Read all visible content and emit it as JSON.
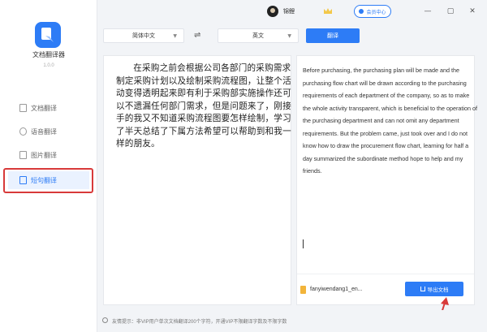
{
  "sidebar": {
    "app_name": "文档翻译器",
    "version": "1.0.0",
    "items": [
      {
        "label": "文档翻译"
      },
      {
        "label": "语音翻译"
      },
      {
        "label": "图片翻译"
      },
      {
        "label": "短句翻译"
      }
    ],
    "active_index": 3
  },
  "titlebar": {
    "username": "锦鲤",
    "vip_label": "会员中心",
    "minimize": "—",
    "maximize": "▢",
    "close": "✕"
  },
  "toolbar": {
    "source_lang": "简体中文",
    "swap_symbol": "⇌",
    "target_lang": "英文",
    "translate_label": "翻译"
  },
  "source_panel": {
    "text": "在采购之前会根据公司各部门的采购需求制定采购计划以及绘制采购流程图，让整个活动变得透明起来即有利于采购部实施操作还可以不遗漏任何部门需求，但是问题来了，刚接手的我又不知道采购流程图要怎样绘制，学习了半天总结了下属方法希望可以帮助到和我一样的朋友。"
  },
  "target_panel": {
    "text": "Before purchasing, the purchasing plan will be made and the purchasing flow chart will be drawn according to the purchasing requirements of each department of the company, so as to make the whole activity transparent, which is beneficial to the operation of the purchasing department and can not omit any department requirements. But the problem came, just took over and I do not know how to draw the procurement flow chart, learning for half a day summarized the subordinate method hope to help and my friends.",
    "file_name": "fanyiwendang1_en...",
    "export_label": "导出文档"
  },
  "footer": {
    "note": "友情提示：非VIP用户单次文档翻译200个字符，开通VIP不限翻译字数及不限字数"
  },
  "colors": {
    "accent": "#2d7cf6",
    "highlight": "#d83a3a",
    "background": "#f2f4f7"
  }
}
